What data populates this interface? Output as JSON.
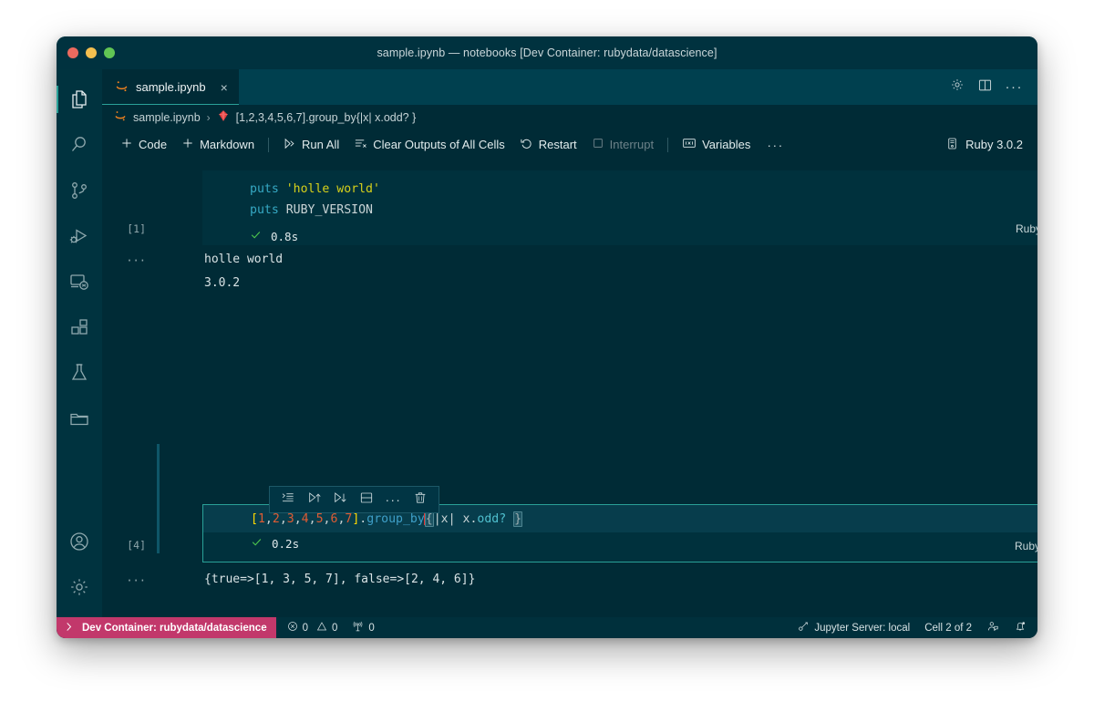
{
  "window": {
    "title": "sample.ipynb — notebooks [Dev Container: rubydata/datascience]",
    "traffic_lights": [
      "close",
      "minimize",
      "zoom"
    ]
  },
  "activity_bar": {
    "items": [
      {
        "name": "explorer",
        "label": "Explorer",
        "icon": "files-icon",
        "active": true
      },
      {
        "name": "search",
        "label": "Search",
        "icon": "search-icon",
        "active": false
      },
      {
        "name": "source-control",
        "label": "Source Control",
        "icon": "source-control-icon",
        "active": false
      },
      {
        "name": "run-debug",
        "label": "Run and Debug",
        "icon": "run-debug-icon",
        "active": false
      },
      {
        "name": "remote-explorer",
        "label": "Remote Explorer",
        "icon": "remote-explorer-icon",
        "active": false
      },
      {
        "name": "extensions",
        "label": "Extensions",
        "icon": "extensions-icon",
        "active": false
      },
      {
        "name": "testing",
        "label": "Testing",
        "icon": "beaker-icon",
        "active": false
      },
      {
        "name": "folder",
        "label": "Folder",
        "icon": "folder-icon",
        "active": false
      }
    ],
    "bottom_items": [
      {
        "name": "account",
        "label": "Accounts",
        "icon": "account-icon"
      },
      {
        "name": "settings",
        "label": "Manage",
        "icon": "gear-icon"
      }
    ]
  },
  "tabs": [
    {
      "label": "sample.ipynb",
      "icon": "jupyter-icon",
      "close": "×",
      "active": true
    }
  ],
  "editor_actions": {
    "settings": "gear-icon",
    "split": "split-editor-icon",
    "more": "···"
  },
  "breadcrumb": {
    "file": "sample.ipynb",
    "separator": "›",
    "file_icon": "jupyter-icon",
    "symbol_icon": "ruby-gem-icon",
    "symbol": "[1,2,3,4,5,6,7].group_by{|x| x.odd? }"
  },
  "notebook_toolbar": {
    "add_code": "Code",
    "add_markdown": "Markdown",
    "run_all": "Run All",
    "clear_outputs": "Clear Outputs of All Cells",
    "restart": "Restart",
    "interrupt": "Interrupt",
    "variables": "Variables",
    "more": "···",
    "kernel": "Ruby 3.0.2"
  },
  "cells": [
    {
      "index": 1,
      "execution_count": "[1]",
      "language": "Ruby",
      "status_icon": "check-icon",
      "duration": "0.8s",
      "code_lines": [
        [
          {
            "t": "puts ",
            "c": "kw"
          },
          {
            "t": "'holle world'",
            "c": "str"
          }
        ],
        [
          {
            "t": "puts ",
            "c": "kw"
          },
          {
            "t": "RUBY_VERSION",
            "c": "const"
          }
        ]
      ],
      "output_marker": "···",
      "output_lines": [
        "holle world",
        "3.0.2"
      ]
    },
    {
      "index": 2,
      "execution_count": "[4]",
      "language": "Ruby",
      "status_icon": "check-icon",
      "duration": "0.2s",
      "selected": true,
      "code_text": "[1,2,3,4,5,6,7].group_by{|x| x.odd? }",
      "output_marker": "···",
      "output_lines": [
        "{true=>[1, 3, 5, 7], false=>[2, 4, 6]}"
      ]
    }
  ],
  "cell_hover_toolbar": {
    "items": [
      {
        "name": "run-by-line",
        "icon": "run-by-line-icon"
      },
      {
        "name": "execute-above-cells",
        "icon": "run-above-icon"
      },
      {
        "name": "execute-cell-and-below",
        "icon": "run-below-icon"
      },
      {
        "name": "split-cell",
        "icon": "split-cell-icon"
      },
      {
        "name": "more-actions",
        "icon": "ellipsis-icon",
        "glyph": "···"
      },
      {
        "name": "delete-cell",
        "icon": "trash-icon"
      }
    ]
  },
  "status_bar": {
    "remote": "Dev Container: rubydata/datascience",
    "remote_icon": "remote-indicator-icon",
    "errors_icon": "error-icon",
    "errors": "0",
    "warnings_icon": "warning-icon",
    "warnings": "0",
    "ports_icon": "radio-tower-icon",
    "ports": "0",
    "jupyter_icon": "jupyter-kernel-icon",
    "jupyter_server": "Jupyter Server: local",
    "cell_position": "Cell 2 of 2",
    "feedback_icon": "feedback-icon",
    "bell_icon": "bell-dot-icon"
  },
  "colors": {
    "accent": "#2aa198",
    "remote_badge": "#c2386b",
    "editor_bg": "#002b36",
    "cell_bg": "#00313d",
    "tabbar_bg": "#00404f",
    "titlebar_bg": "#00323f",
    "success": "#4ec94e",
    "cursor": "#e03030"
  }
}
